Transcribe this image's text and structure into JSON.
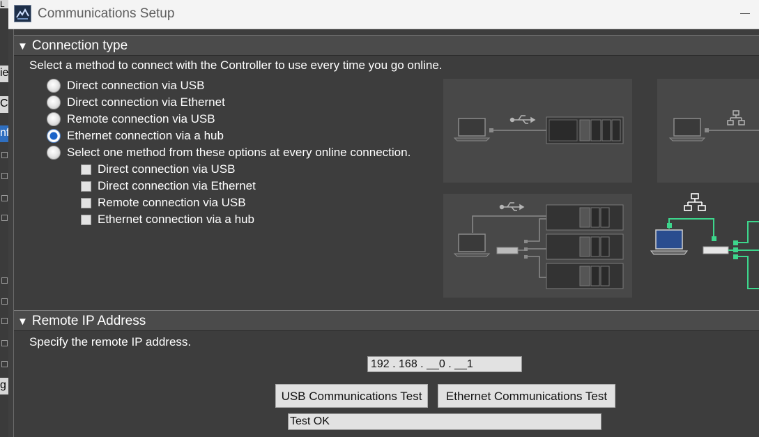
{
  "window": {
    "title": "Communications Setup"
  },
  "connection_type": {
    "header": "Connection type",
    "description": "Select a method to connect with the Controller to use every time you go online.",
    "options": [
      {
        "label": "Direct connection via USB",
        "selected": false
      },
      {
        "label": "Direct connection via Ethernet",
        "selected": false
      },
      {
        "label": "Remote connection via USB",
        "selected": false
      },
      {
        "label": "Ethernet connection via a hub",
        "selected": true
      },
      {
        "label": "Select one method from these options at every online connection.",
        "selected": false
      }
    ],
    "sub_options": [
      {
        "label": "Direct connection via USB",
        "checked": false
      },
      {
        "label": "Direct connection via Ethernet",
        "checked": false
      },
      {
        "label": "Remote connection via USB",
        "checked": false
      },
      {
        "label": "Ethernet connection via a hub",
        "checked": false
      }
    ]
  },
  "remote_ip": {
    "header": "Remote IP Address",
    "description": "Specify the remote IP address.",
    "ip_value": "192 . 168 . __0 . __1",
    "usb_test_label": "USB Communications Test",
    "ethernet_test_label": "Ethernet Communications Test",
    "status_text": "Test OK"
  },
  "background": {
    "fragments": [
      "L",
      "ie",
      "C",
      "nf",
      "g"
    ]
  },
  "colors": {
    "accent_green": "#3dd68c",
    "selected_radio": "#1a63c9",
    "dialog_bg": "#3d3d3d"
  }
}
